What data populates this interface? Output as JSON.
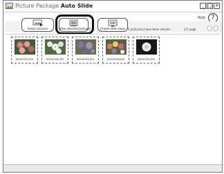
{
  "window": {
    "title_prefix": "Picture Package",
    "title_main": "Auto Slide",
    "controls": {
      "minimize": "_",
      "maximize": "□",
      "close": "×"
    }
  },
  "help": {
    "label": "Help",
    "icon": "?"
  },
  "toolbar": {
    "select_label": "Select pictures",
    "view_label": "View selected pictures",
    "slide_label": "Create slide show"
  },
  "status": {
    "selected_text": "5 picture(s) have been selecte",
    "page_text": "1/1 page"
  },
  "thumbnails": [
    {
      "label": "DSC00001.JPG",
      "kind": "pink-flowers"
    },
    {
      "label": "DSC00002.JPG",
      "kind": "white-flowers"
    },
    {
      "label": "DSC00003.JPG",
      "kind": "purple-flowers"
    },
    {
      "label": "DSC00004.JPG",
      "kind": "mixed-flowers"
    },
    {
      "label": "DSC00005.JPG",
      "kind": "dark-flower"
    }
  ]
}
